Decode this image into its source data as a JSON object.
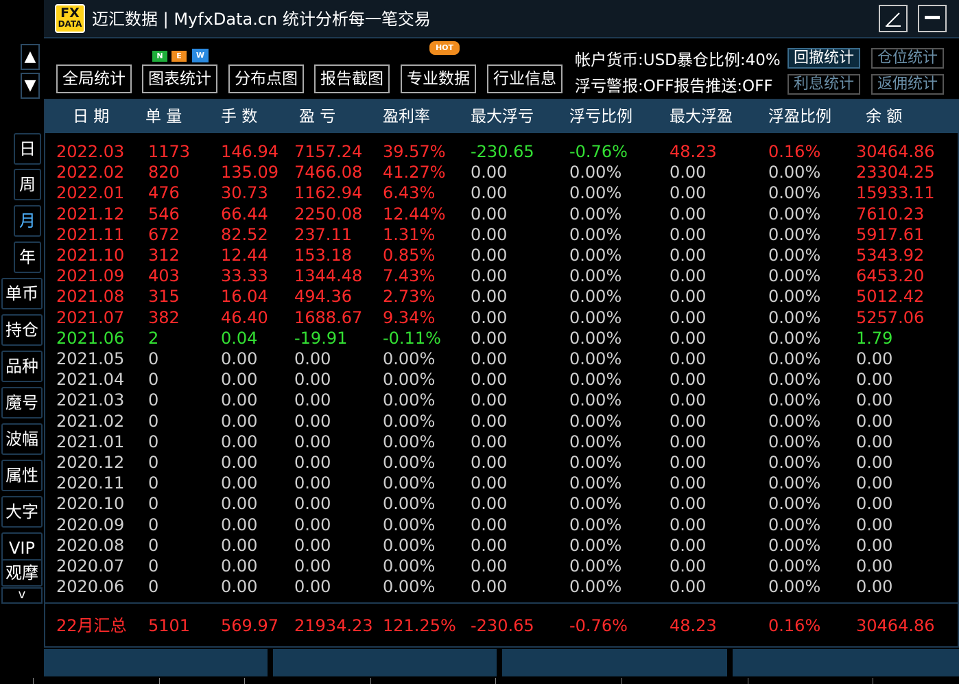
{
  "app": {
    "logo_top": "FX",
    "logo_bottom": "DATA",
    "title": "迈汇数据 | MyfxData.cn  统计分析每一笔交易"
  },
  "nav": {
    "up": "▲",
    "down": "▼"
  },
  "sidebar": [
    {
      "label": "日",
      "narrow": true
    },
    {
      "label": "周",
      "narrow": true
    },
    {
      "label": "月",
      "narrow": true,
      "active": true
    },
    {
      "label": "年",
      "narrow": true
    },
    {
      "label": "单币"
    },
    {
      "label": "持仓"
    },
    {
      "label": "品种"
    },
    {
      "label": "魔号"
    },
    {
      "label": "波幅"
    },
    {
      "label": "属性"
    },
    {
      "label": "大字"
    },
    {
      "label": "VIP"
    },
    {
      "label": "观摩"
    }
  ],
  "sidebar_more": "v",
  "toolbar": {
    "buttons": [
      "全局统计",
      "图表统计",
      "分布点图",
      "报告截图",
      "专业数据",
      "行业信息"
    ],
    "badges": {
      "new_n": "N",
      "new_e": "E",
      "new_w": "W",
      "hot": "HOT"
    },
    "info_line1": "帐户货币:USD暴仓比例:40%",
    "info_line2": "浮亏警报:OFF报告推送:OFF",
    "side_buttons": [
      "回撤统计",
      "仓位统计",
      "利息统计",
      "返佣统计"
    ]
  },
  "colors": {
    "header_bg": "#1c3f5a",
    "loss": "#33e033",
    "profit": "#ff2a2a",
    "neutral": "#cfcfcf"
  },
  "table": {
    "headers": [
      "日 期",
      "单 量",
      "手 数",
      "盈 亏",
      "盈利率",
      "最大浮亏",
      "浮亏比例",
      "最大浮盈",
      "浮盈比例",
      "余 额"
    ],
    "rows": [
      [
        "2022.03",
        "1173",
        "146.94",
        "7157.24",
        "39.57%",
        "-230.65",
        "-0.76%",
        "48.23",
        "0.16%",
        "30464.86"
      ],
      [
        "2022.02",
        "820",
        "135.09",
        "7466.08",
        "41.27%",
        "0.00",
        "0.00%",
        "0.00",
        "0.00%",
        "23304.25"
      ],
      [
        "2022.01",
        "476",
        "30.73",
        "1162.94",
        "6.43%",
        "0.00",
        "0.00%",
        "0.00",
        "0.00%",
        "15933.11"
      ],
      [
        "2021.12",
        "546",
        "66.44",
        "2250.08",
        "12.44%",
        "0.00",
        "0.00%",
        "0.00",
        "0.00%",
        "7610.23"
      ],
      [
        "2021.11",
        "672",
        "82.52",
        "237.11",
        "1.31%",
        "0.00",
        "0.00%",
        "0.00",
        "0.00%",
        "5917.61"
      ],
      [
        "2021.10",
        "312",
        "12.44",
        "153.18",
        "0.85%",
        "0.00",
        "0.00%",
        "0.00",
        "0.00%",
        "5343.92"
      ],
      [
        "2021.09",
        "403",
        "33.33",
        "1344.48",
        "7.43%",
        "0.00",
        "0.00%",
        "0.00",
        "0.00%",
        "6453.20"
      ],
      [
        "2021.08",
        "315",
        "16.04",
        "494.36",
        "2.73%",
        "0.00",
        "0.00%",
        "0.00",
        "0.00%",
        "5012.42"
      ],
      [
        "2021.07",
        "382",
        "46.40",
        "1688.67",
        "9.34%",
        "0.00",
        "0.00%",
        "0.00",
        "0.00%",
        "5257.06"
      ],
      [
        "2021.06",
        "2",
        "0.04",
        "-19.91",
        "-0.11%",
        "0.00",
        "0.00%",
        "0.00",
        "0.00%",
        "1.79"
      ],
      [
        "2021.05",
        "0",
        "0.00",
        "0.00",
        "0.00%",
        "0.00",
        "0.00%",
        "0.00",
        "0.00%",
        "0.00"
      ],
      [
        "2021.04",
        "0",
        "0.00",
        "0.00",
        "0.00%",
        "0.00",
        "0.00%",
        "0.00",
        "0.00%",
        "0.00"
      ],
      [
        "2021.03",
        "0",
        "0.00",
        "0.00",
        "0.00%",
        "0.00",
        "0.00%",
        "0.00",
        "0.00%",
        "0.00"
      ],
      [
        "2021.02",
        "0",
        "0.00",
        "0.00",
        "0.00%",
        "0.00",
        "0.00%",
        "0.00",
        "0.00%",
        "0.00"
      ],
      [
        "2021.01",
        "0",
        "0.00",
        "0.00",
        "0.00%",
        "0.00",
        "0.00%",
        "0.00",
        "0.00%",
        "0.00"
      ],
      [
        "2020.12",
        "0",
        "0.00",
        "0.00",
        "0.00%",
        "0.00",
        "0.00%",
        "0.00",
        "0.00%",
        "0.00"
      ],
      [
        "2020.11",
        "0",
        "0.00",
        "0.00",
        "0.00%",
        "0.00",
        "0.00%",
        "0.00",
        "0.00%",
        "0.00"
      ],
      [
        "2020.10",
        "0",
        "0.00",
        "0.00",
        "0.00%",
        "0.00",
        "0.00%",
        "0.00",
        "0.00%",
        "0.00"
      ],
      [
        "2020.09",
        "0",
        "0.00",
        "0.00",
        "0.00%",
        "0.00",
        "0.00%",
        "0.00",
        "0.00%",
        "0.00"
      ],
      [
        "2020.08",
        "0",
        "0.00",
        "0.00",
        "0.00%",
        "0.00",
        "0.00%",
        "0.00",
        "0.00%",
        "0.00"
      ],
      [
        "2020.07",
        "0",
        "0.00",
        "0.00",
        "0.00%",
        "0.00",
        "0.00%",
        "0.00",
        "0.00%",
        "0.00"
      ],
      [
        "2020.06",
        "0",
        "0.00",
        "0.00",
        "0.00%",
        "0.00",
        "0.00%",
        "0.00",
        "0.00%",
        "0.00"
      ]
    ],
    "summary": [
      "22月汇总",
      "5101",
      "569.97",
      "21934.23",
      "121.25%",
      "-230.65",
      "-0.76%",
      "48.23",
      "0.16%",
      "30464.86"
    ]
  }
}
